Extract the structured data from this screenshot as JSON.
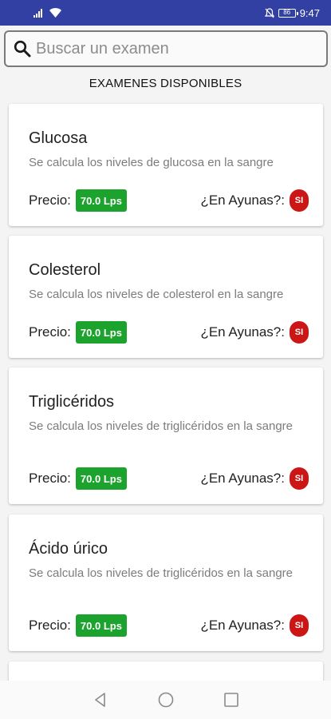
{
  "status_bar": {
    "time": "9:47",
    "battery": "86"
  },
  "search": {
    "placeholder": "Buscar un examen"
  },
  "section_title": "EXAMENES DISPONIBLES",
  "exams": [
    {
      "title": "Glucosa",
      "description": "Se calcula los niveles de glucosa en la sangre",
      "price_label": "Precio:",
      "price": "70.0 Lps",
      "fasting_label": "¿En Ayunas?:",
      "fasting_value": "SI"
    },
    {
      "title": "Colesterol",
      "description": "Se calcula los niveles de colesterol en la sangre",
      "price_label": "Precio:",
      "price": "70.0 Lps",
      "fasting_label": "¿En Ayunas?:",
      "fasting_value": "SI"
    },
    {
      "title": "Triglicéridos",
      "description": "Se calcula los niveles de triglicéridos en la sangre",
      "price_label": "Precio:",
      "price": "70.0 Lps",
      "fasting_label": "¿En Ayunas?:",
      "fasting_value": "SI"
    },
    {
      "title": "Ácido úrico",
      "description": "Se calcula los niveles de triglicéridos en la sangre",
      "price_label": "Precio:",
      "price": "70.0 Lps",
      "fasting_label": "¿En Ayunas?:",
      "fasting_value": "SI"
    }
  ],
  "icons": {
    "search": "search-icon",
    "back": "back-icon",
    "home": "home-icon",
    "recents": "recents-icon",
    "signal": "signal-icon",
    "wifi": "wifi-icon",
    "mute": "mute-icon",
    "battery": "battery-icon"
  },
  "colors": {
    "status_bar": "#3340a3",
    "price_badge": "#1ba32e",
    "fasting_badge": "#cc1616"
  }
}
